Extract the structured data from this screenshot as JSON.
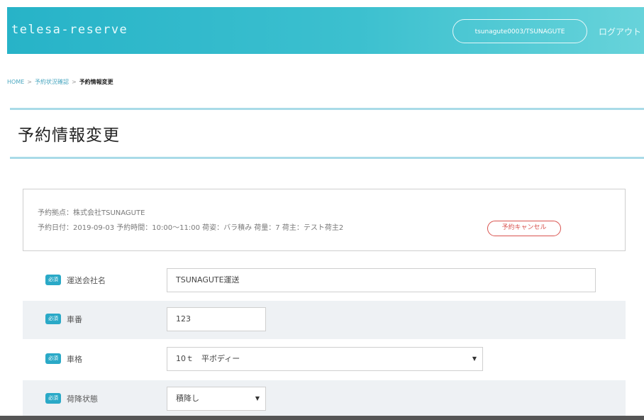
{
  "header": {
    "app_title": "telesa-reserve",
    "user_label": "tsunagute0003/TSUNAGUTE",
    "logout_label": "ログアウト"
  },
  "breadcrumb": {
    "home": "HOME",
    "parent": "予約状況確認",
    "current": "予約情報変更"
  },
  "page": {
    "title": "予約情報変更"
  },
  "reservation_info": {
    "location": "予約拠点：株式会社TSUNAGUTE",
    "details": "予約日付：2019-09-03 予約時間：10:00〜11:00 荷姿：バラ積み 荷量：7 荷主：テスト荷主2",
    "cancel_label": "予約キャンセル"
  },
  "form": {
    "required_label": "必須",
    "fields": [
      {
        "label": "運送会社名",
        "value": "TSUNAGUTE運送"
      },
      {
        "label": "車番",
        "value": "123"
      },
      {
        "label": "車格",
        "value": "10ｔ　平ボディー"
      },
      {
        "label": "荷降状態",
        "value": "積降し"
      }
    ]
  },
  "colors": {
    "header_start": "#27b3c8",
    "header_end": "#67d3da",
    "accent": "#2aa9c7",
    "danger": "#d9534f"
  }
}
